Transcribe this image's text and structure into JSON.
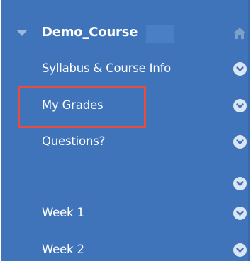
{
  "course": {
    "title": "Demo_Course",
    "icons": {
      "expand": "caret-down-icon",
      "home": "home-icon"
    }
  },
  "menu": {
    "items": [
      {
        "label": "Syllabus & Course Info",
        "icon": "chevron-down-icon"
      },
      {
        "label": "My Grades",
        "icon": "chevron-down-icon",
        "highlighted": true
      },
      {
        "label": "Questions?",
        "icon": "chevron-down-icon"
      },
      {
        "label": "",
        "type": "divider",
        "icon": "chevron-down-icon"
      },
      {
        "label": "Week 1",
        "icon": "chevron-down-icon"
      },
      {
        "label": "Week 2",
        "icon": "chevron-down-icon"
      }
    ]
  },
  "colors": {
    "panel_bg": "#3f74ba",
    "text": "#ffffff",
    "highlight_border": "#e84c3d"
  }
}
